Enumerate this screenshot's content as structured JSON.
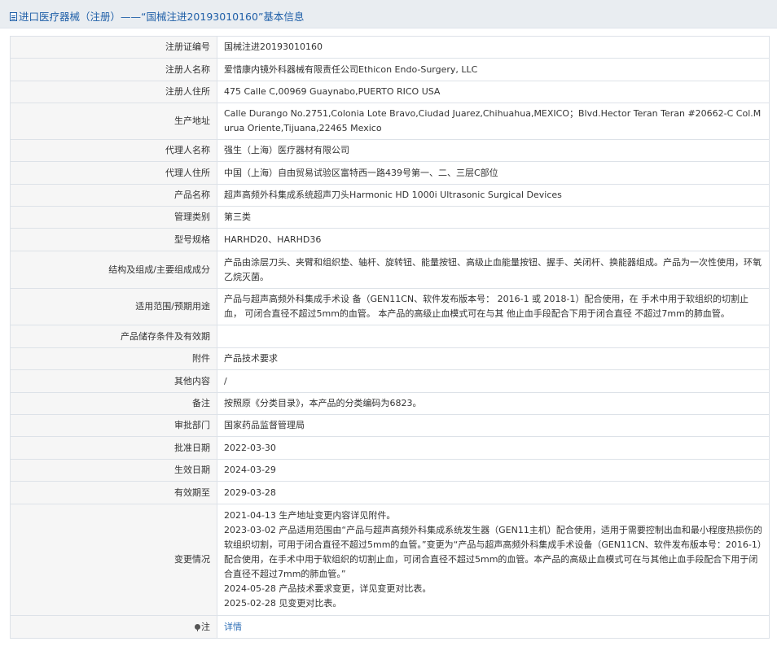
{
  "header": {
    "title": "进口医疗器械（注册）——“国械注进20193010160”基本信息"
  },
  "rows": [
    {
      "label": "注册证编号",
      "value": "国械注进20193010160"
    },
    {
      "label": "注册人名称",
      "value": "爱惜康内镜外科器械有限责任公司Ethicon Endo-Surgery, LLC"
    },
    {
      "label": "注册人住所",
      "value": "475 Calle C,00969 Guaynabo,PUERTO RICO USA"
    },
    {
      "label": "生产地址",
      "value": "Calle Durango No.2751,Colonia Lote Bravo,Ciudad Juarez,Chihuahua,MEXICO；Blvd.Hector Teran Teran #20662-C Col.Murua Oriente,Tijuana,22465 Mexico"
    },
    {
      "label": "代理人名称",
      "value": "强生（上海）医疗器材有限公司"
    },
    {
      "label": "代理人住所",
      "value": "中国（上海）自由贸易试验区富特西一路439号第一、二、三层C部位"
    },
    {
      "label": "产品名称",
      "value": "超声高频外科集成系统超声刀头Harmonic HD 1000i Ultrasonic Surgical Devices"
    },
    {
      "label": "管理类别",
      "value": "第三类"
    },
    {
      "label": "型号规格",
      "value": "HARHD20、HARHD36"
    },
    {
      "label": "结构及组成/主要组成成分",
      "value": "产品由涂层刀头、夹臂和组织垫、轴杆、旋转钮、能量按钮、高级止血能量按钮、握手、关闭杆、换能器组成。产品为一次性使用，环氧乙烷灭菌。"
    },
    {
      "label": "适用范围/预期用途",
      "value": "产品与超声高频外科集成手术设 备（GEN11CN、软件发布版本号： 2016-1 或 2018-1）配合使用，在 手术中用于软组织的切割止血， 可闭合直径不超过5mm的血管。 本产品的高级止血模式可在与其 他止血手段配合下用于闭合直径 不超过7mm的肺血管。"
    },
    {
      "label": "产品储存条件及有效期",
      "value": ""
    },
    {
      "label": "附件",
      "value": "产品技术要求"
    },
    {
      "label": "其他内容",
      "value": "/"
    },
    {
      "label": "备注",
      "value": "按照原《分类目录》，本产品的分类编码为6823。"
    },
    {
      "label": "审批部门",
      "value": "国家药品监督管理局"
    },
    {
      "label": "批准日期",
      "value": "2022-03-30"
    },
    {
      "label": "生效日期",
      "value": "2024-03-29"
    },
    {
      "label": "有效期至",
      "value": "2029-03-28"
    }
  ],
  "changes": {
    "label": "变更情况",
    "lines": [
      "2021-04-13 生产地址变更内容详见附件。",
      "2023-03-02 产品适用范围由“产品与超声高频外科集成系统发生器（GEN11主机）配合使用，适用于需要控制出血和最小程度热损伤的软组织切割，可用于闭合直径不超过5mm的血管。”变更为“产品与超声高频外科集成手术设备（GEN11CN、软件发布版本号：2016-1）配合使用，在手术中用于软组织的切割止血，可闭合直径不超过5mm的血管。本产品的高级止血模式可在与其他止血手段配合下用于闭合直径不超过7mm的肺血管。”",
      "2024-05-28 产品技术要求变更，详见变更对比表。",
      "2025-02-28 见变更对比表。"
    ]
  },
  "note": {
    "label": "注",
    "icon": "pin-icon",
    "link_text": "详情",
    "link_color": "#2f6fb6"
  },
  "colors": {
    "title_text": "#1f5fa8",
    "label_background": "#f6f6f6",
    "border": "#dde2e8"
  }
}
